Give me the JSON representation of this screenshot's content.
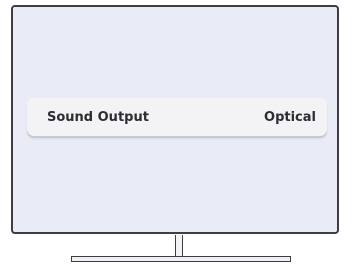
{
  "menu": {
    "label": "Sound Output",
    "value": "Optical"
  },
  "colors": {
    "screen_background": "#e9ecf6",
    "frame": "#3d3d46",
    "menu_item_background": "#f3f3f6",
    "text": "#2c2c34"
  }
}
